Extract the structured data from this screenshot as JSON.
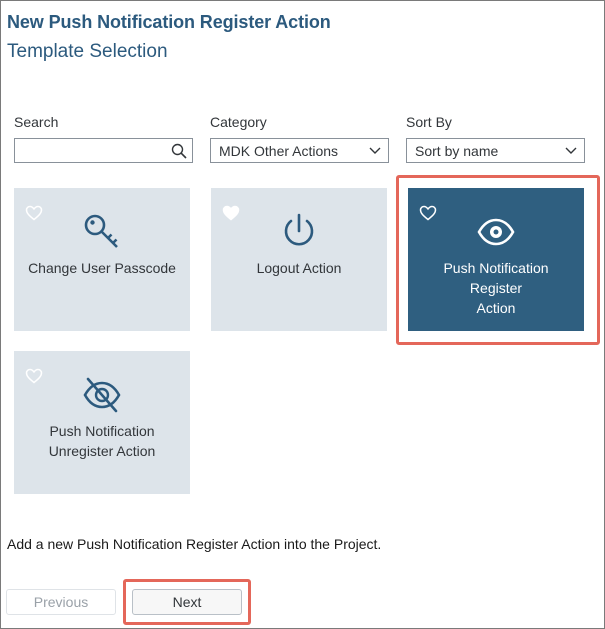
{
  "header": {
    "title": "New Push Notification Register Action",
    "subtitle": "Template Selection"
  },
  "filters": {
    "search": {
      "label": "Search",
      "value": "",
      "icon": "search-icon"
    },
    "category": {
      "label": "Category",
      "value": "MDK Other Actions",
      "icon": "chevron-down-icon"
    },
    "sort": {
      "label": "Sort By",
      "value": "Sort by name",
      "icon": "chevron-down-icon"
    }
  },
  "tiles": [
    {
      "label_line1": "Change User Passcode",
      "label_line2": "",
      "icon": "key-icon",
      "favorite": "heart-outline-icon",
      "selected": false
    },
    {
      "label_line1": "Logout Action",
      "label_line2": "",
      "icon": "power-icon",
      "favorite": "heart-filled-icon",
      "selected": false
    },
    {
      "label_line1": "Push Notification Register",
      "label_line2": "Action",
      "icon": "eye-icon",
      "favorite": "heart-outline-icon",
      "selected": true
    },
    {
      "label_line1": "Push Notification",
      "label_line2": "Unregister Action",
      "icon": "eye-slash-icon",
      "favorite": "heart-outline-icon",
      "selected": false
    }
  ],
  "description": "Add a new Push Notification Register Action into the Project.",
  "footer": {
    "previous_label": "Previous",
    "next_label": "Next"
  },
  "colors": {
    "accent": "#2c5a7e",
    "tile_bg": "#dde4ea",
    "tile_selected_bg": "#2f5f80",
    "highlight": "#e4675a"
  }
}
